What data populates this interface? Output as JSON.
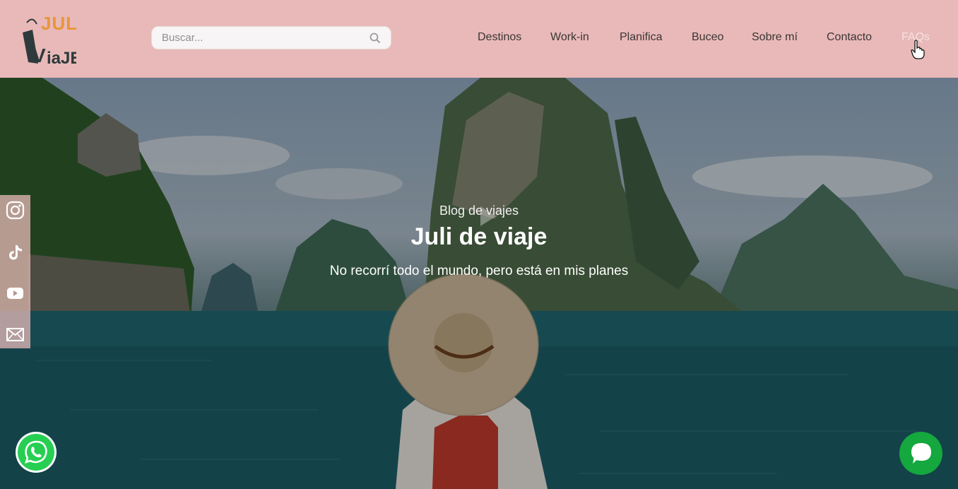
{
  "header": {
    "logo_alt": "Juli de viaje logo",
    "search": {
      "placeholder": "Buscar..."
    },
    "nav": [
      {
        "label": "Destinos"
      },
      {
        "label": "Work-in"
      },
      {
        "label": "Planifica"
      },
      {
        "label": "Buceo"
      },
      {
        "label": "Sobre mí"
      },
      {
        "label": "Contacto"
      },
      {
        "label": "FAQs"
      }
    ]
  },
  "hero": {
    "subtitle": "Blog de viajes",
    "title": "Juli de viaje",
    "tagline": "No recorrí todo el mundo, pero está en mis planes"
  },
  "social": [
    "instagram-icon",
    "tiktok-icon",
    "youtube-icon",
    "mail-icon"
  ],
  "colors": {
    "header_bg": "#e8b9b8",
    "logo_orange": "#e8963c",
    "logo_dark": "#2f3a3c",
    "whatsapp": "#26cf52",
    "chat": "#14a83e"
  }
}
